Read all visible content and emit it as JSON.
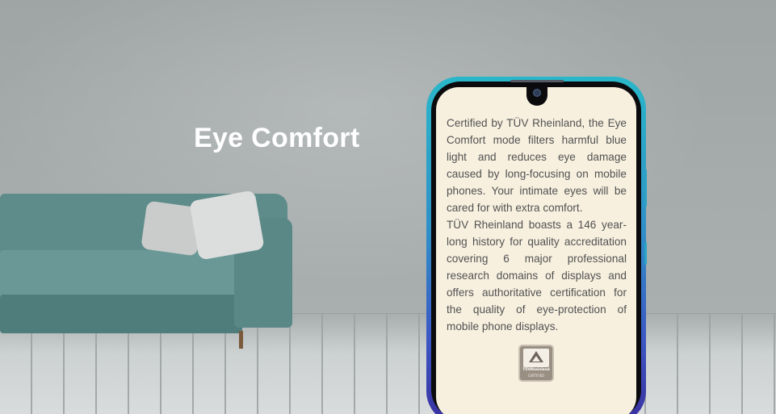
{
  "headline": "Eye Comfort",
  "paragraph1": "Certified by TÜV Rheinland, the Eye Comfort mode filters harmful blue light and reduces eye damage caused by long-focusing on mobile phones. Your intimate eyes will be cared for with extra comfort.",
  "paragraph2": "TÜV Rheinland boasts a 146 year-long history for quality accreditation covering 6 major professional research domains of displays and offers authoritative certification for the quality of eye-protection of mobile phone displays.",
  "badge": {
    "brand": "TÜVRheinland",
    "label": "CERTIFIED"
  },
  "colors": {
    "headline": "#ffffff",
    "screen_bg": "#f7f0df",
    "frame_top": "#2ab7c9",
    "frame_bottom": "#3a2f9f",
    "sofa": "#5e8c8a"
  },
  "icons": [
    "tuv-certified-badge-icon",
    "front-camera-icon"
  ]
}
